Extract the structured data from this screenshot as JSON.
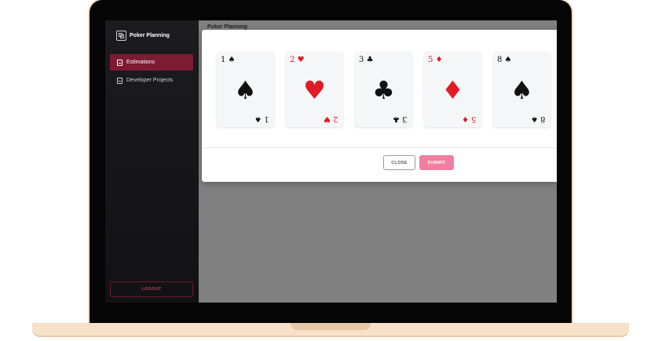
{
  "app": {
    "brand": "Poker Planning",
    "page_title": "Poker Planning"
  },
  "sidebar": {
    "items": [
      {
        "label": "Estimations",
        "active": true
      },
      {
        "label": "Developer Projects",
        "active": false
      }
    ],
    "logout_label": "LOGOUT"
  },
  "modal": {
    "cards": [
      {
        "value": "1",
        "suit": "♠",
        "color": "#111111"
      },
      {
        "value": "2",
        "suit": "♥",
        "color": "#e01b24"
      },
      {
        "value": "3",
        "suit": "♣",
        "color": "#111111"
      },
      {
        "value": "5",
        "suit": "♦",
        "color": "#e01b24"
      },
      {
        "value": "8",
        "suit": "♠",
        "color": "#111111"
      }
    ],
    "close_label": "CLOSE",
    "submit_label": "SUBMIT"
  },
  "colors": {
    "accent": "#7c1b32",
    "submit": "#ef7fa1",
    "backdrop": "#808080"
  }
}
